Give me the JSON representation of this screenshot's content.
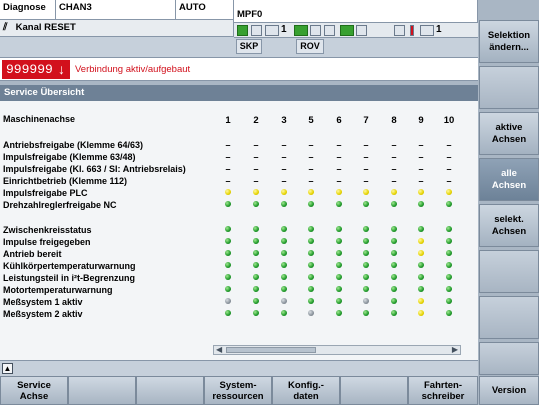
{
  "header": {
    "area": "Diagnose",
    "channel": "CHAN3",
    "mode": "AUTO",
    "program": "MPF0",
    "channel_status": "Kanal RESET",
    "icon_counter_1": "1",
    "icon_counter_2": "1",
    "skp": "SKP",
    "rov": "ROV"
  },
  "alarm": {
    "number": "999999",
    "arrow": "↓",
    "text": "Verbindung aktiv/aufgebaut"
  },
  "title": "Service Übersicht",
  "table": {
    "axis_label": "Maschinenachse",
    "columns": [
      "1",
      "2",
      "3",
      "5",
      "6",
      "7",
      "8",
      "9",
      "10"
    ],
    "rows": [
      {
        "label": "Antriebsfreigabe (Klemme 64/63)",
        "cells": [
          "–",
          "–",
          "–",
          "–",
          "–",
          "–",
          "–",
          "–",
          "–"
        ]
      },
      {
        "label": "Impulsfreigabe (Klemme 63/48)",
        "cells": [
          "–",
          "–",
          "–",
          "–",
          "–",
          "–",
          "–",
          "–",
          "–"
        ]
      },
      {
        "label": "Impulsfreigabe (Kl. 663 / SI: Antriebsrelais)",
        "cells": [
          "–",
          "–",
          "–",
          "–",
          "–",
          "–",
          "–",
          "–",
          "–"
        ]
      },
      {
        "label": "Einrichtbetrieb (Klemme 112)",
        "cells": [
          "–",
          "–",
          "–",
          "–",
          "–",
          "–",
          "–",
          "–",
          "–"
        ]
      },
      {
        "label": "Impulsfreigabe PLC",
        "cells": [
          "yellow",
          "yellow",
          "yellow",
          "yellow",
          "yellow",
          "yellow",
          "yellow",
          "yellow",
          "yellow"
        ]
      },
      {
        "label": "Drehzahlreglerfreigabe NC",
        "cells": [
          "green",
          "green",
          "green",
          "green",
          "green",
          "green",
          "green",
          "green",
          "green"
        ]
      },
      {
        "label": "Zwischenkreisstatus",
        "cells": [
          "green",
          "green",
          "green",
          "green",
          "green",
          "green",
          "green",
          "green",
          "green"
        ]
      },
      {
        "label": "Impulse freigegeben",
        "cells": [
          "green",
          "green",
          "green",
          "green",
          "green",
          "green",
          "green",
          "yellow",
          "green"
        ]
      },
      {
        "label": "Antrieb bereit",
        "cells": [
          "green",
          "green",
          "green",
          "green",
          "green",
          "green",
          "green",
          "yellow",
          "green"
        ]
      },
      {
        "label": "Kühlkörpertemperaturwarnung",
        "cells": [
          "green",
          "green",
          "green",
          "green",
          "green",
          "green",
          "green",
          "green",
          "green"
        ]
      },
      {
        "label": "Leistungsteil in i²t-Begrenzung",
        "cells": [
          "green",
          "green",
          "green",
          "green",
          "green",
          "green",
          "green",
          "green",
          "green"
        ]
      },
      {
        "label": "Motortemperaturwarnung",
        "cells": [
          "green",
          "green",
          "green",
          "green",
          "green",
          "green",
          "green",
          "green",
          "green"
        ]
      },
      {
        "label": "Meßsystem 1 aktiv",
        "cells": [
          "gray",
          "green",
          "gray",
          "green",
          "green",
          "gray",
          "green",
          "yellow",
          "green"
        ]
      },
      {
        "label": "Meßsystem 2 aktiv",
        "cells": [
          "green",
          "green",
          "green",
          "gray",
          "green",
          "green",
          "green",
          "yellow",
          "green"
        ]
      }
    ]
  },
  "vertical_softkeys": [
    {
      "label": "Selektion\nändern...",
      "state": "normal"
    },
    {
      "label": "",
      "state": "blank"
    },
    {
      "label": "aktive\nAchsen",
      "state": "normal"
    },
    {
      "label": "alle\nAchsen",
      "state": "active"
    },
    {
      "label": "selekt.\nAchsen",
      "state": "normal"
    },
    {
      "label": "",
      "state": "blank"
    },
    {
      "label": "",
      "state": "blank"
    },
    {
      "label": "",
      "state": "blank"
    }
  ],
  "horizontal_softkeys": [
    {
      "label": "Service\nAchse"
    },
    {
      "label": ""
    },
    {
      "label": ""
    },
    {
      "label": "System-\nressourcen"
    },
    {
      "label": "Konfig.-\ndaten"
    },
    {
      "label": ""
    },
    {
      "label": "Fahrten-\nschreiber"
    },
    {
      "label": "Version"
    }
  ],
  "colors": {
    "alarm_red": "#d2101c",
    "title_bar": "#6e8196",
    "status_green": "#1f9a2a",
    "status_yellow": "#e6d400",
    "status_gray": "#8a939c"
  },
  "icons": {
    "channel_status": "reset-icon",
    "expand": "expand-up-icon",
    "alarm_arrow": "arrow-down-icon"
  }
}
